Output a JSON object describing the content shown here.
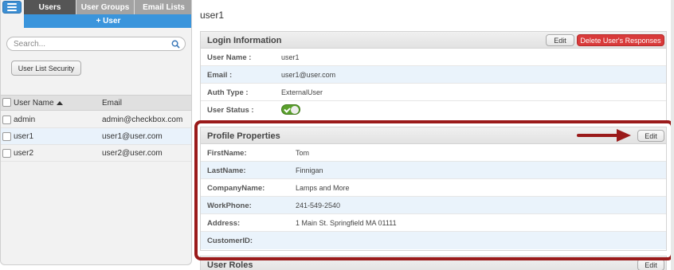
{
  "left": {
    "tabs": [
      {
        "label": "Users"
      },
      {
        "label": "User Groups"
      },
      {
        "label": "Email Lists"
      }
    ],
    "add_user_label": "+ User",
    "search": {
      "placeholder": "Search...",
      "value": ""
    },
    "security_button": "User List Security",
    "list": {
      "headers": {
        "name": "User Name",
        "email": "Email"
      },
      "rows": [
        {
          "name": "admin",
          "email": "admin@checkbox.com"
        },
        {
          "name": "user1",
          "email": "user1@user.com"
        },
        {
          "name": "user2",
          "email": "user2@user.com"
        }
      ]
    }
  },
  "main": {
    "title": "user1",
    "login": {
      "title": "Login Information",
      "edit_label": "Edit",
      "delete_label": "Delete User's Responses",
      "fields": [
        {
          "label": "User Name :",
          "value": "user1"
        },
        {
          "label": "Email :",
          "value": "user1@user.com"
        },
        {
          "label": "Auth Type :",
          "value": "ExternalUser"
        },
        {
          "label": "User Status :",
          "value": ""
        }
      ],
      "status_enabled": true
    },
    "profile": {
      "title": "Profile Properties",
      "edit_label": "Edit",
      "fields": [
        {
          "label": "FirstName:",
          "value": "Tom"
        },
        {
          "label": "LastName:",
          "value": "Finnigan"
        },
        {
          "label": "CompanyName:",
          "value": "Lamps and More"
        },
        {
          "label": "WorkPhone:",
          "value": "241-549-2540"
        },
        {
          "label": "Address:",
          "value": "1 Main St. Springfield MA 01111"
        },
        {
          "label": "CustomerID:",
          "value": ""
        }
      ]
    },
    "roles": {
      "title": "User Roles",
      "edit_label": "Edit"
    }
  },
  "colors": {
    "accent": "#3a95dc",
    "highlight": "#9a1a1a",
    "danger": "#d93a3a"
  }
}
